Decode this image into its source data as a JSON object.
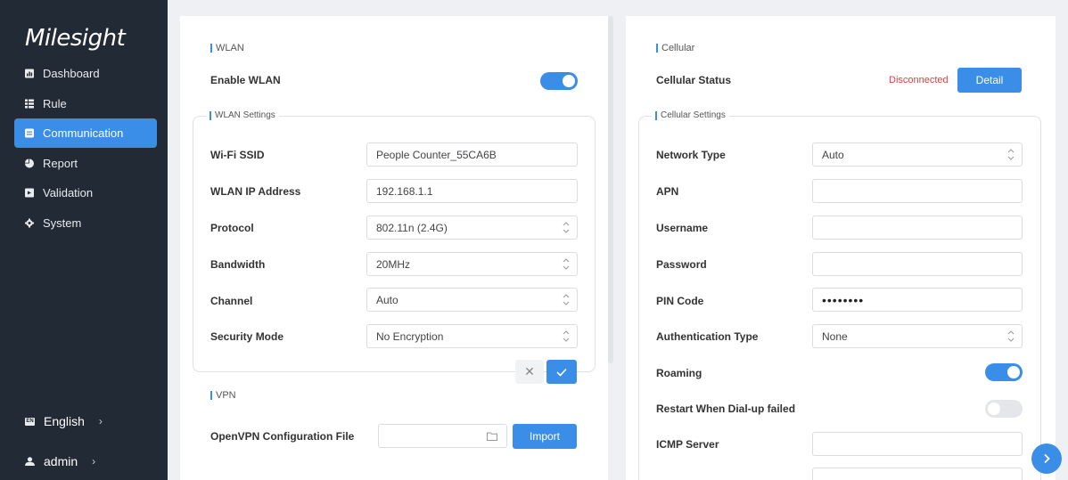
{
  "sidebar": {
    "logo": "Milesight",
    "items": [
      {
        "label": "Dashboard",
        "icon": "chart-icon"
      },
      {
        "label": "Rule",
        "icon": "list-icon"
      },
      {
        "label": "Communication",
        "icon": "message-icon",
        "active": true
      },
      {
        "label": "Report",
        "icon": "pie-icon"
      },
      {
        "label": "Validation",
        "icon": "check-doc-icon"
      },
      {
        "label": "System",
        "icon": "gear-icon"
      }
    ],
    "language": "English",
    "language_icon": "en-flag-icon",
    "user": "admin",
    "user_icon": "user-icon"
  },
  "wlan": {
    "title": "WLAN",
    "enable_label": "Enable WLAN",
    "enabled": true,
    "settings_title": "WLAN Settings",
    "ssid_label": "Wi-Fi SSID",
    "ssid_value": "People Counter_55CA6B",
    "ip_label": "WLAN IP Address",
    "ip_value": "192.168.1.1",
    "protocol_label": "Protocol",
    "protocol_value": "802.11n (2.4G)",
    "bandwidth_label": "Bandwidth",
    "bandwidth_value": "20MHz",
    "channel_label": "Channel",
    "channel_value": "Auto",
    "security_label": "Security Mode",
    "security_value": "No Encryption"
  },
  "vpn": {
    "title": "VPN",
    "openvpn_label": "OpenVPN Configuration File",
    "import_label": "Import"
  },
  "cellular": {
    "title": "Cellular",
    "status_label": "Cellular Status",
    "status_value": "Disconnected",
    "detail_label": "Detail",
    "settings_title": "Cellular Settings",
    "network_type_label": "Network Type",
    "network_type_value": "Auto",
    "apn_label": "APN",
    "apn_value": "",
    "username_label": "Username",
    "username_value": "",
    "password_label": "Password",
    "password_value": "",
    "pin_label": "PIN Code",
    "pin_value": "••••••••",
    "auth_label": "Authentication Type",
    "auth_value": "None",
    "roaming_label": "Roaming",
    "roaming_enabled": true,
    "restart_label": "Restart When Dial-up failed",
    "restart_enabled": false,
    "icmp_label": "ICMP Server",
    "icmp_value": ""
  },
  "colors": {
    "accent": "#3b8ee8",
    "sidebar_bg": "#222a35",
    "status_error": "#e0413f"
  }
}
